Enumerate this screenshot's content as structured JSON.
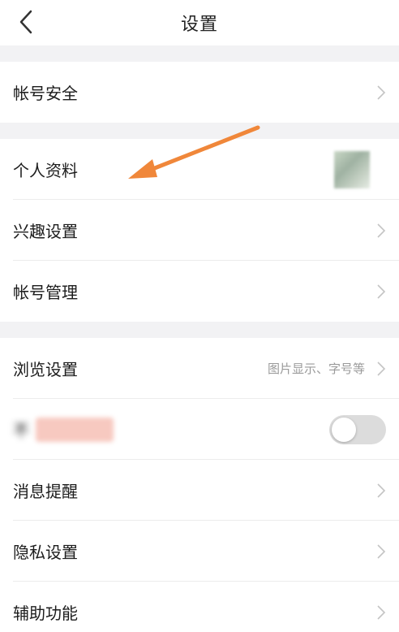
{
  "header": {
    "title": "设置"
  },
  "sections": {
    "account_security": {
      "label": "帐号安全"
    },
    "personal_info": {
      "label": "个人资料"
    },
    "interest": {
      "label": "兴趣设置"
    },
    "account_manage": {
      "label": "帐号管理"
    },
    "browse": {
      "label": "浏览设置",
      "hint": "图片显示、字号等"
    },
    "blurred_toggle": {
      "label": "不",
      "toggle_on": false
    },
    "notification": {
      "label": "消息提醒"
    },
    "privacy": {
      "label": "隐私设置"
    },
    "accessibility": {
      "label": "辅助功能"
    }
  },
  "colors": {
    "annotation_arrow": "#f0873a",
    "section_gap": "#f2f2f4",
    "chevron": "#c4c4c4"
  }
}
